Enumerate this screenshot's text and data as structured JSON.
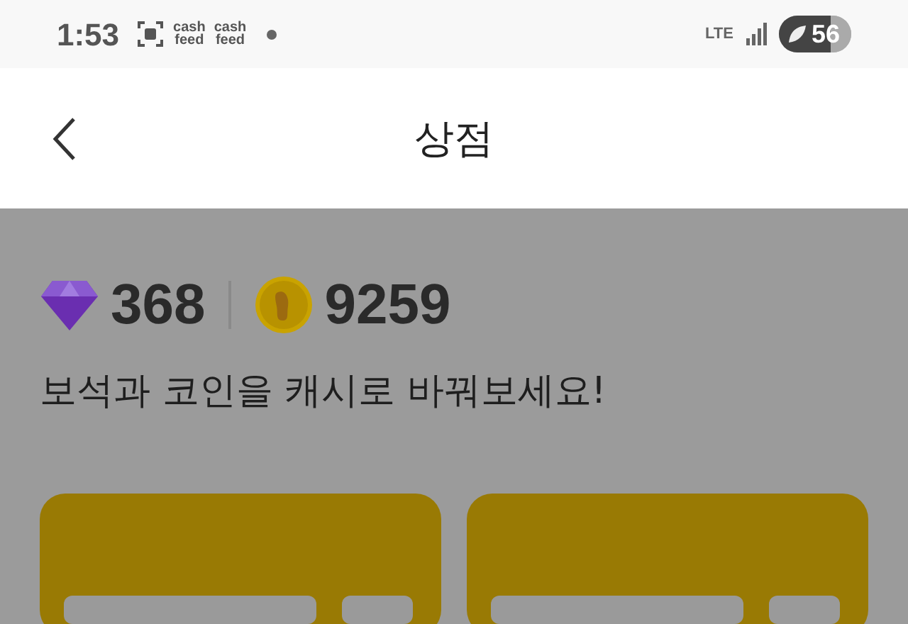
{
  "status_bar": {
    "time": "1:53",
    "notifications": [
      {
        "kind": "screenshot"
      },
      {
        "kind": "logo",
        "top": "cash",
        "bottom": "feed"
      },
      {
        "kind": "logo",
        "top": "cash",
        "bottom": "feed"
      },
      {
        "kind": "dot"
      }
    ],
    "network": "LTE",
    "battery": "56"
  },
  "header": {
    "title": "상점"
  },
  "balance": {
    "gems": "368",
    "coins": "9259"
  },
  "message": "보석과 코인을 캐시로 바꿔보세요!",
  "cards": [
    {
      "kind": "card"
    },
    {
      "kind": "card"
    }
  ]
}
